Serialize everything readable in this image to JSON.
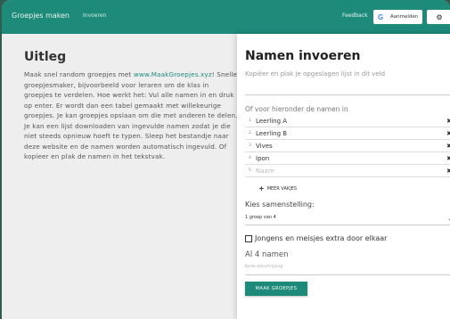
{
  "header": {
    "brand": "Groepjes maken",
    "nav_item": "Invoeren",
    "feedback": "Feedback",
    "login_label": "Aanmelden",
    "settings_icon": "gear-icon"
  },
  "explanation": {
    "title": "Uitleg",
    "intro": "Maak snel random groepjes met ",
    "link": "www.MaakGroepjes.xyz",
    "body": "! Snelle groepjesmaker, bijvoorbeeld voor leraren om de klas in groepjes te verdelen. Hoe werkt het: Vul alle namen in en druk op enter. Er wordt dan een tabel gemaakt met willekeurige groepjes. Je kan groepjes opslaan om die met anderen te delen. Je kan een lijst downloaden van ingevulde namen zodat je die niet steeds opnieuw hoeft te typen. Sleep het bestandje naar deze website en de namen worden automatisch ingevuld. Of kopieer en plak de namen in het tekstvak."
  },
  "panel": {
    "title": "Namen invoeren",
    "paste_placeholder": "Kopiëer en plak je opgeslagen lijst in dit veld",
    "subhead": "Of voor hieronder de namen in",
    "names": [
      {
        "num": "1",
        "value": "Leerling A"
      },
      {
        "num": "2",
        "value": "Leerling B"
      },
      {
        "num": "3",
        "value": "Vives"
      },
      {
        "num": "4",
        "value": "Ipon"
      }
    ],
    "empty_row": {
      "num": "5",
      "placeholder": "Naam"
    },
    "more_label": "MEER VAKJES",
    "composition_label": "Kies samenstelling:",
    "composition_value": "1 groep van 4",
    "mix_label": "Jongens en meisjes extra door elkaar",
    "count_text": "Al 4 namen",
    "description_placeholder": "Korte omschrijving",
    "make_button": "MAAK GROEPJES"
  }
}
